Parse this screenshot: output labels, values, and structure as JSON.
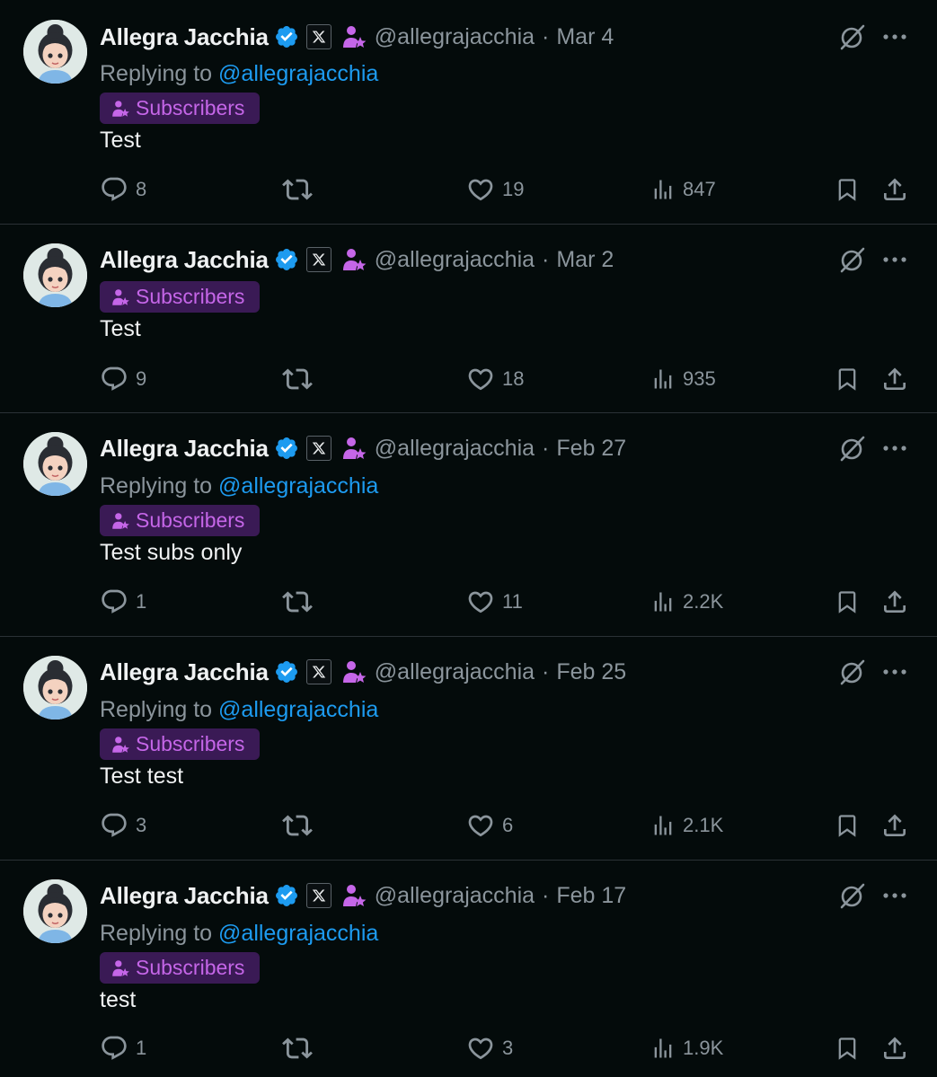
{
  "colors": {
    "background": "#040b0b",
    "muted": "#8b959c",
    "link": "#1d9bf0",
    "verified": "#1d9bf0",
    "subscriber": "#c566e8",
    "subscriber_pill": "#3a1a55"
  },
  "icons": {
    "reply": "reply-icon",
    "repost": "repost-icon",
    "like": "like-icon",
    "views": "views-icon",
    "bookmark": "bookmark-icon",
    "share": "share-icon",
    "grok": "grok-icon",
    "more": "more-icon",
    "verified": "verified-badge-icon",
    "x_badge": "x-affiliate-badge-icon",
    "subscriber": "subscriber-icon"
  },
  "posts": [
    {
      "name": "Allegra Jacchia",
      "handle": "@allegrajacchia",
      "separator": "·",
      "date": "Mar 4",
      "replying_prefix": "Replying to",
      "replying_to": "@allegrajacchia",
      "badge": "Subscribers",
      "text": "Test",
      "replies": "8",
      "reposts": "",
      "likes": "19",
      "views": "847"
    },
    {
      "name": "Allegra Jacchia",
      "handle": "@allegrajacchia",
      "separator": "·",
      "date": "Mar 2",
      "replying_prefix": "",
      "replying_to": "",
      "badge": "Subscribers",
      "text": "Test",
      "replies": "9",
      "reposts": "",
      "likes": "18",
      "views": "935"
    },
    {
      "name": "Allegra Jacchia",
      "handle": "@allegrajacchia",
      "separator": "·",
      "date": "Feb 27",
      "replying_prefix": "Replying to",
      "replying_to": "@allegrajacchia",
      "badge": "Subscribers",
      "text": "Test subs only",
      "replies": "1",
      "reposts": "",
      "likes": "11",
      "views": "2.2K"
    },
    {
      "name": "Allegra Jacchia",
      "handle": "@allegrajacchia",
      "separator": "·",
      "date": "Feb 25",
      "replying_prefix": "Replying to",
      "replying_to": "@allegrajacchia",
      "badge": "Subscribers",
      "text": "Test test",
      "replies": "3",
      "reposts": "",
      "likes": "6",
      "views": "2.1K"
    },
    {
      "name": "Allegra Jacchia",
      "handle": "@allegrajacchia",
      "separator": "·",
      "date": "Feb 17",
      "replying_prefix": "Replying to",
      "replying_to": "@allegrajacchia",
      "badge": "Subscribers",
      "text": "test",
      "replies": "1",
      "reposts": "",
      "likes": "3",
      "views": "1.9K"
    }
  ]
}
